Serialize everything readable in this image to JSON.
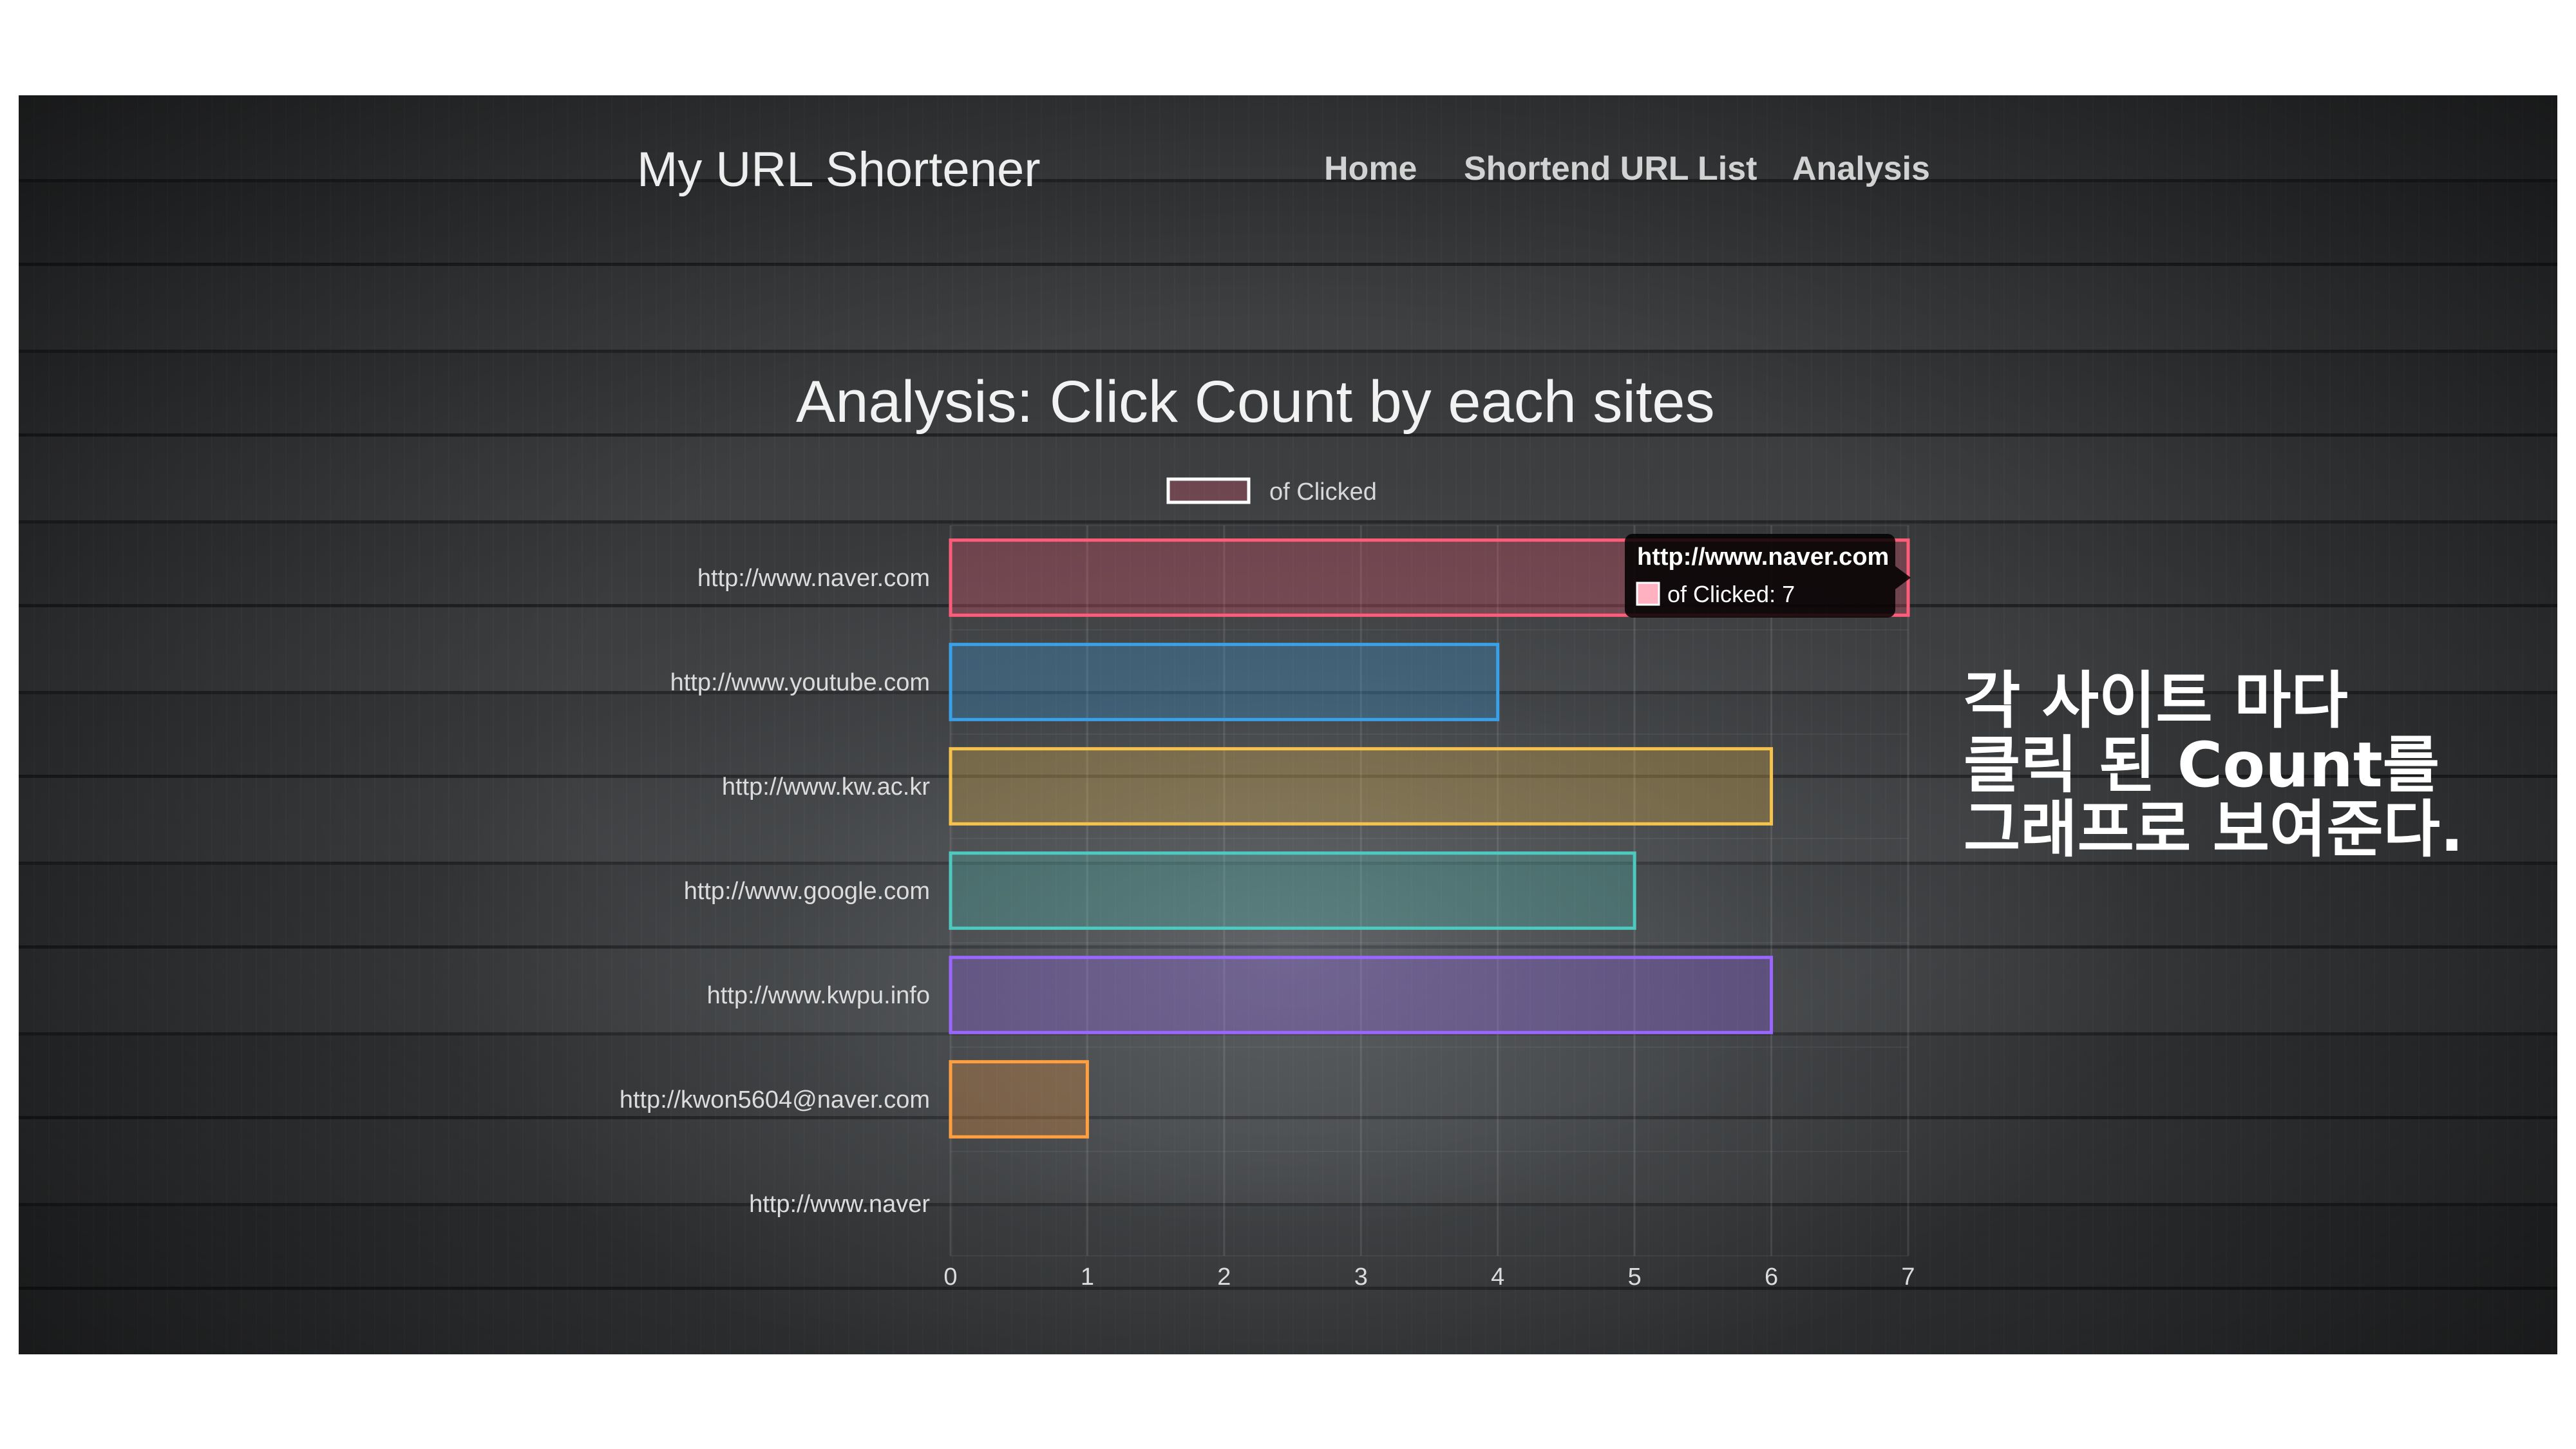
{
  "header": {
    "app_title": "My URL Shortener",
    "nav": [
      {
        "label": "Home"
      },
      {
        "label": "Shortend URL List"
      },
      {
        "label": "Analysis"
      }
    ]
  },
  "page_title": "Analysis: Click Count by each sites",
  "chart_data": {
    "type": "bar",
    "orientation": "horizontal",
    "legend": {
      "label": "of Clicked",
      "position": "top"
    },
    "categories": [
      "http://www.naver.com",
      "http://www.youtube.com",
      "http://www.kw.ac.kr",
      "http://www.google.com",
      "http://www.kwpu.info",
      "http://kwon5604@naver.com",
      "http://www.naver"
    ],
    "series": [
      {
        "name": "of Clicked",
        "values": [
          7,
          4,
          6,
          5,
          6,
          1,
          0
        ]
      }
    ],
    "bar_colors": [
      "#ff5c7a",
      "#3aa0e8",
      "#f5c24d",
      "#4ec9c0",
      "#9a66ff",
      "#ff9f40",
      "#c9cbcf"
    ],
    "xlim": [
      0,
      7
    ],
    "x_ticks": [
      "0",
      "1",
      "2",
      "3",
      "4",
      "5",
      "6",
      "7"
    ],
    "grid": true,
    "tooltip": {
      "title": "http://www.naver.com",
      "label": "of Clicked: 7",
      "swatch_color": "#ffb1c1"
    }
  },
  "annotation": {
    "lines": [
      "각 사이트 마다",
      "클릭 된 Count를",
      "그래프로 보여준다."
    ]
  }
}
